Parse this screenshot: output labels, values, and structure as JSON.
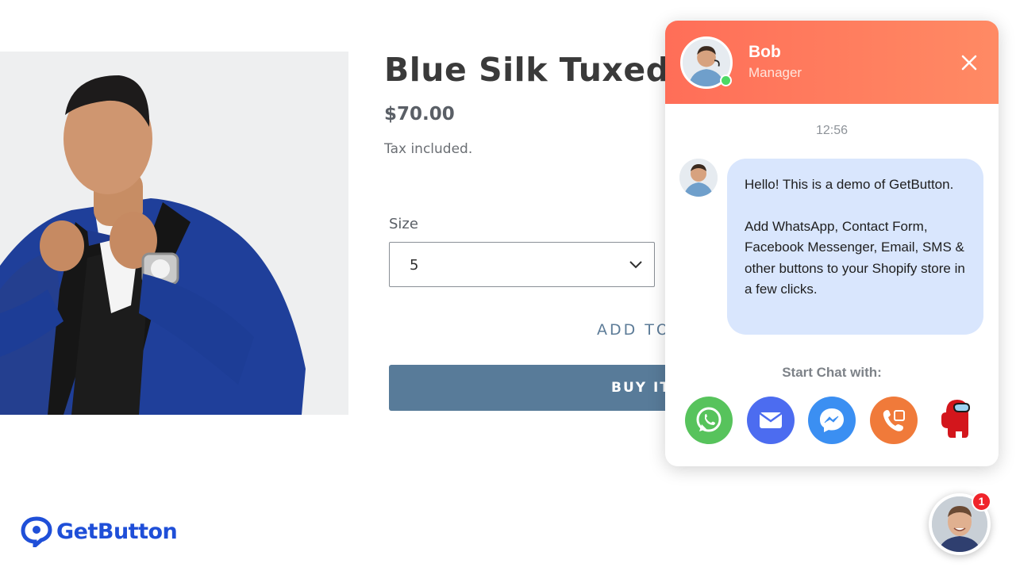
{
  "product": {
    "title": "Blue Silk Tuxedo",
    "price": "$70.00",
    "tax_note": "Tax included.",
    "size_label": "Size",
    "size_value": "5",
    "add_to_cart_label": "ADD TO CART",
    "buy_now_label": "BUY IT NOW"
  },
  "brand": {
    "name": "GetButton",
    "color": "#1f4fd8"
  },
  "chat": {
    "agent_name": "Bob",
    "agent_role": "Manager",
    "online_status_color": "#4cd964",
    "header_color": "#ff7a5e",
    "timestamp": "12:56",
    "message_line1": "Hello! This is a demo of GetButton.",
    "message_line2": "Add WhatsApp, Contact Form, Facebook Messenger, Email, SMS & other buttons to your Shopify store in a few clicks.",
    "start_chat_label": "Start Chat with:",
    "channels": [
      {
        "name": "WhatsApp",
        "icon": "whatsapp-icon",
        "color": "#54c35a"
      },
      {
        "name": "Email",
        "icon": "email-icon",
        "color": "#4f6cf0"
      },
      {
        "name": "Facebook Messenger",
        "icon": "messenger-icon",
        "color": "#2f8cf4"
      },
      {
        "name": "Phone",
        "icon": "phone-icon",
        "color": "#f07a3a"
      },
      {
        "name": "Among Us",
        "icon": "among-us-icon",
        "color": "#e01e1e"
      }
    ]
  },
  "launcher": {
    "badge_count": "1"
  }
}
